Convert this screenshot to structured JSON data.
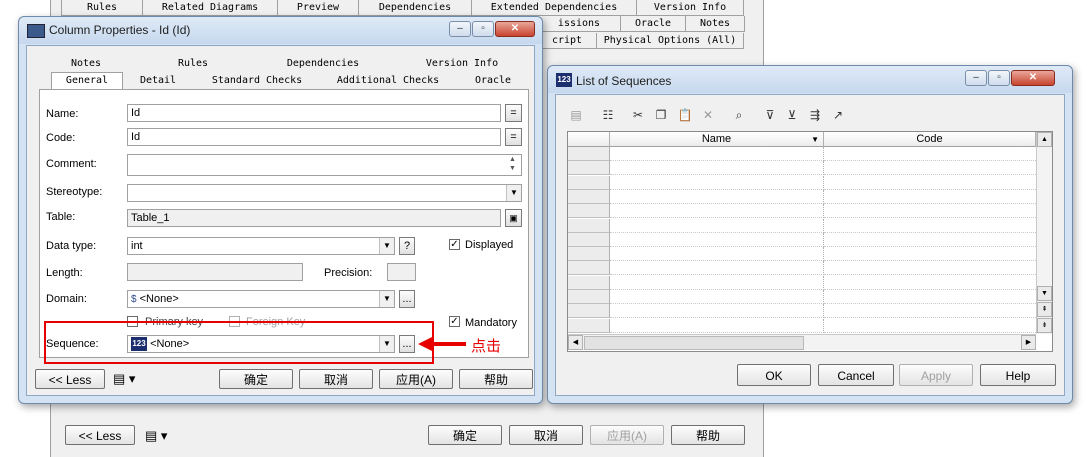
{
  "background_window": {
    "tabs_row1": [
      "Rules",
      "Related Diagrams",
      "Preview",
      "Dependencies",
      "Extended Dependencies",
      "Version Info"
    ],
    "tabs_row2": [
      "issions",
      "Oracle",
      "Notes"
    ],
    "tabs_row3": [
      "cript",
      "Physical Options (All)"
    ],
    "buttons": {
      "less": "<< Less",
      "ok": "确定",
      "cancel": "取消",
      "apply": "应用(A)",
      "help": "帮助"
    }
  },
  "column_dialog": {
    "title": "Column Properties - Id (Id)",
    "tabs_row1": [
      "Notes",
      "Rules",
      "Dependencies",
      "Version Info"
    ],
    "tabs_row2": [
      "General",
      "Detail",
      "Standard Checks",
      "Additional Checks",
      "Oracle"
    ],
    "fields": {
      "name_label": "Name:",
      "name_value": "Id",
      "code_label": "Code:",
      "code_value": "Id",
      "comment_label": "Comment:",
      "comment_value": "",
      "stereotype_label": "Stereotype:",
      "stereotype_value": "",
      "table_label": "Table:",
      "table_value": "Table_1",
      "datatype_label": "Data type:",
      "datatype_value": "int",
      "length_label": "Length:",
      "length_value": "",
      "precision_label": "Precision:",
      "precision_value": "",
      "domain_label": "Domain:",
      "domain_value": "<None>",
      "sequence_label": "Sequence:",
      "sequence_value": "<None>",
      "eq_button": "=",
      "help_button": "?",
      "more_button": "..."
    },
    "checks": {
      "displayed": {
        "label": "Displayed",
        "checked": true
      },
      "primary_key": {
        "label": "Primary key",
        "checked": false
      },
      "foreign_key": {
        "label": "Foreign Key",
        "checked": false
      },
      "mandatory": {
        "label": "Mandatory",
        "checked": true
      }
    },
    "buttons": {
      "less": "<< Less",
      "ok": "确定",
      "cancel": "取消",
      "apply": "应用(A)",
      "help": "帮助"
    }
  },
  "annotation": {
    "text": "点击",
    "color": "#e60000"
  },
  "sequence_dialog": {
    "title": "List of Sequences",
    "columns": [
      "Name",
      "Code"
    ],
    "rows": 13,
    "buttons": {
      "ok": "OK",
      "cancel": "Cancel",
      "apply": "Apply",
      "help": "Help"
    }
  }
}
